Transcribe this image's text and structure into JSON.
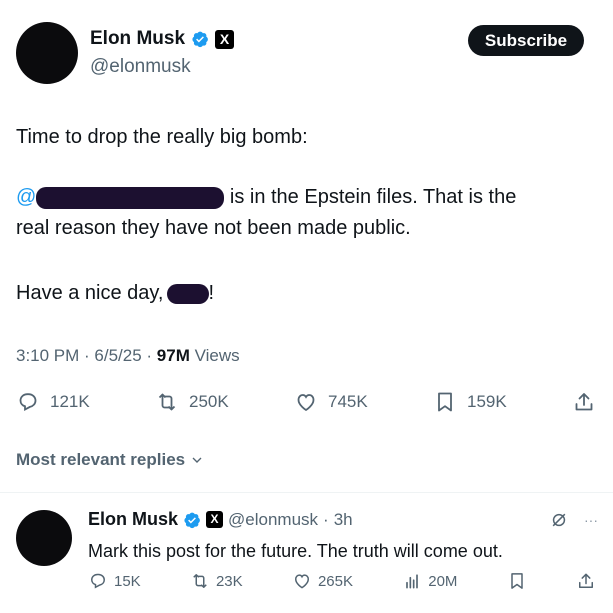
{
  "post": {
    "author_name": "Elon Musk",
    "author_handle": "@elonmusk",
    "subscribe_label": "Subscribe",
    "x_badge": "X",
    "text_line1": "Time to drop the really big bomb:",
    "mention_prefix": "@",
    "text_line2_tail": "is in the Epstein files. That is the",
    "text_line3": "real reason they have not been made public.",
    "text_line4": "Have a nice day,",
    "text_line4_end": "!",
    "time": "3:10 PM",
    "date": "6/5/25",
    "views_count": "97M",
    "views_label": "Views",
    "replies": "121K",
    "reposts": "250K",
    "likes": "745K",
    "bookmarks": "159K"
  },
  "replies_section": {
    "sort_label": "Most relevant replies"
  },
  "reply": {
    "author_name": "Elon Musk",
    "x_badge": "X",
    "author_handle": "@elonmusk",
    "age": "3h",
    "more": "···",
    "text": "Mark this post for the future. The truth will come out.",
    "replies": "15K",
    "reposts": "23K",
    "likes": "265K",
    "views": "20M"
  },
  "colors": {
    "accent": "#1d9bf0",
    "text": "#0f1419",
    "secondary": "#536471",
    "redaction": "#1c1030"
  }
}
